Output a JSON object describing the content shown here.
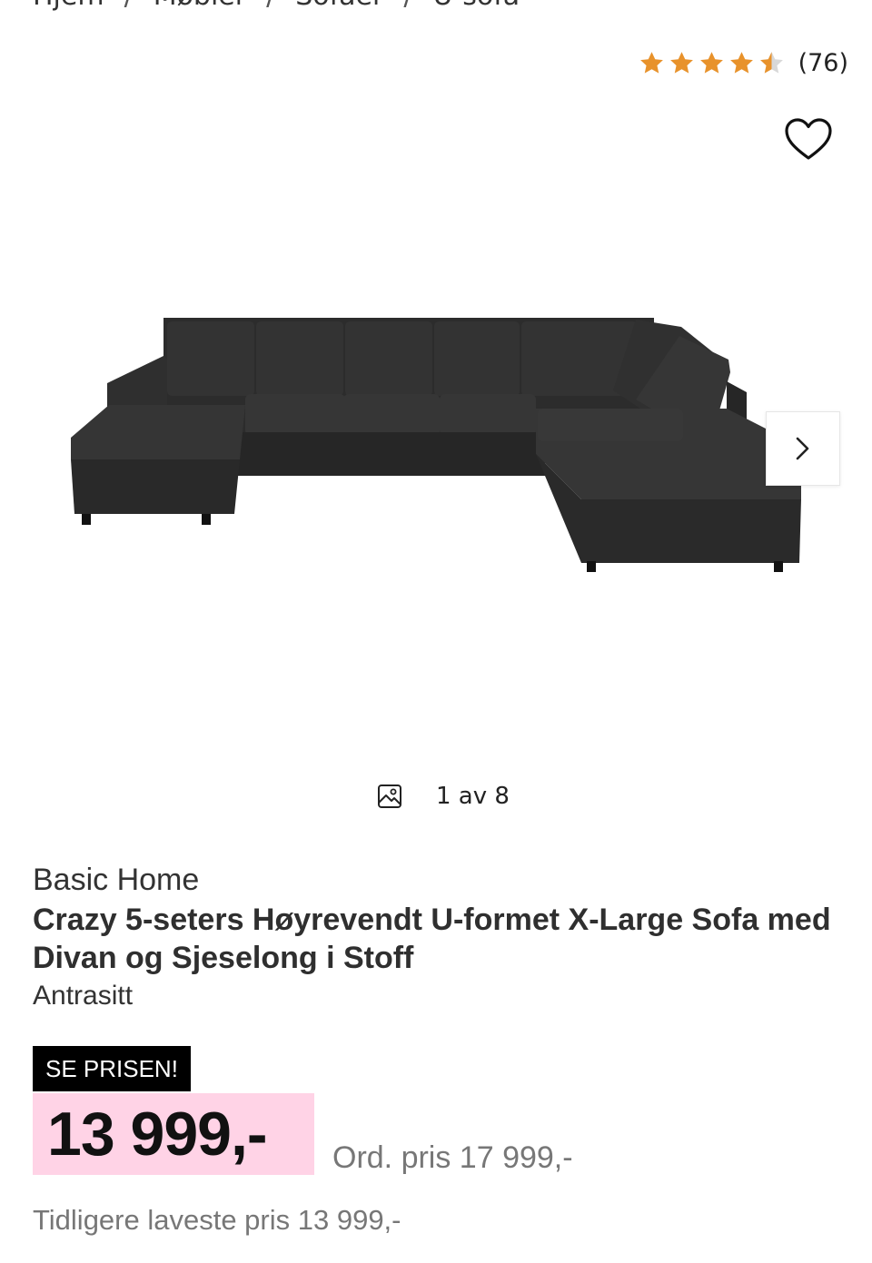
{
  "breadcrumb": {
    "items": [
      "Hjem",
      "Møbler",
      "Sofaer",
      "U-sofa"
    ],
    "separator": "/"
  },
  "rating": {
    "value": 4.5,
    "max": 5,
    "count_label": "(76)",
    "star_color": "#e8922b"
  },
  "wishlist": {
    "icon": "heart-icon"
  },
  "gallery": {
    "counter_label": "1 av 8",
    "next_icon": "chevron-right-icon",
    "image_icon": "image-icon"
  },
  "product": {
    "brand": "Basic Home",
    "title": "Crazy 5-seters Høyrevendt U-formet X-Large Sofa med Divan og Sjeselong i Stoff",
    "variant": "Antrasitt"
  },
  "price": {
    "badge": "SE PRISEN!",
    "current": "13 999,-",
    "ordinary": "Ord. pris 17 999,-",
    "lowest_previous": "Tidligere laveste pris 13 999,-",
    "highlight_color": "#ffd3e6"
  }
}
